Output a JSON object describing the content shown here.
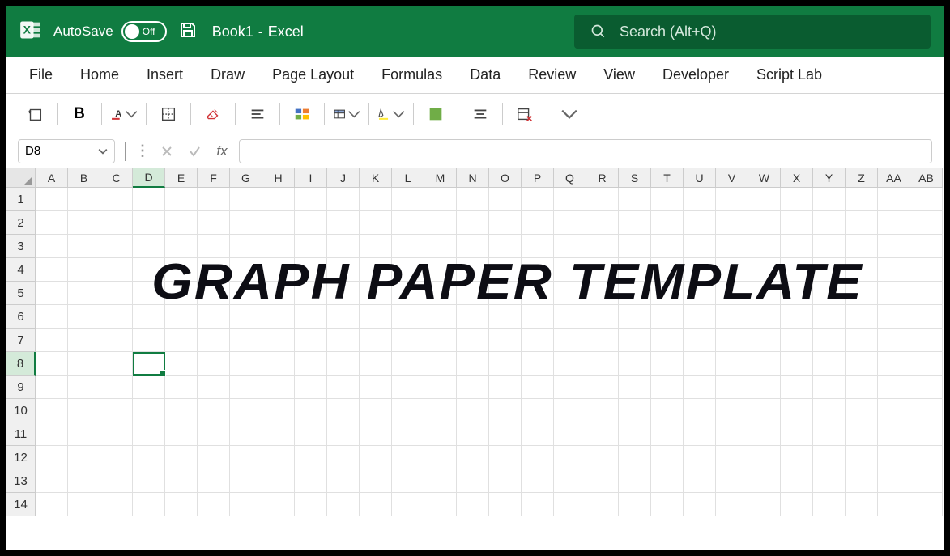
{
  "titlebar": {
    "autosave_label": "AutoSave",
    "autosave_state": "Off",
    "doc_name": "Book1",
    "app_name": "Excel"
  },
  "search": {
    "placeholder": "Search (Alt+Q)"
  },
  "ribbon_tabs": [
    "File",
    "Home",
    "Insert",
    "Draw",
    "Page Layout",
    "Formulas",
    "Data",
    "Review",
    "View",
    "Developer",
    "Script Lab"
  ],
  "formula_bar": {
    "name_box": "D8",
    "fx_label": "fx",
    "value": ""
  },
  "columns": [
    "A",
    "B",
    "C",
    "D",
    "E",
    "F",
    "G",
    "H",
    "I",
    "J",
    "K",
    "L",
    "M",
    "N",
    "O",
    "P",
    "Q",
    "R",
    "S",
    "T",
    "U",
    "V",
    "W",
    "X",
    "Y",
    "Z",
    "AA",
    "AB"
  ],
  "rows": [
    "1",
    "2",
    "3",
    "4",
    "5",
    "6",
    "7",
    "8",
    "9",
    "10",
    "11",
    "12",
    "13",
    "14"
  ],
  "active_cell": {
    "col": "D",
    "row": "8"
  },
  "overlay_text": "GRAPH PAPER TEMPLATE",
  "icons": {
    "bold": "B"
  }
}
